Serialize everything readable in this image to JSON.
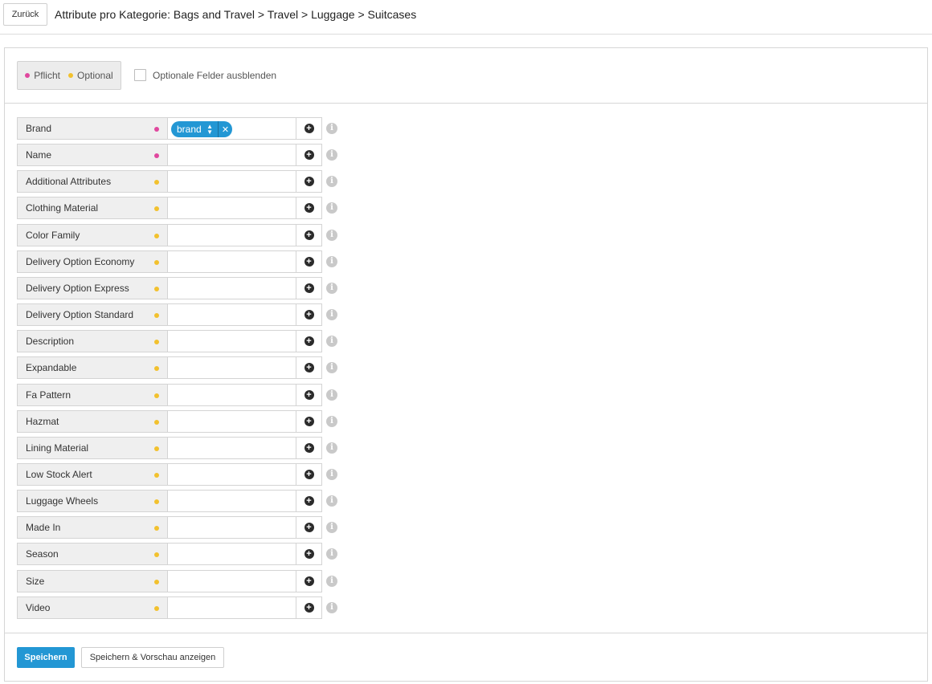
{
  "header": {
    "back_label": "Zurück",
    "title": "Attribute pro Kategorie: Bags and Travel > Travel > Luggage > Suitcases"
  },
  "legend": {
    "required_label": "Pflicht",
    "optional_label": "Optional",
    "required_color": "#e0479e",
    "optional_color": "#f2c12e"
  },
  "hide_optional": {
    "label": "Optionale Felder ausblenden",
    "checked": false
  },
  "attributes": [
    {
      "label": "Brand",
      "required": true,
      "tag": "brand"
    },
    {
      "label": "Name",
      "required": true
    },
    {
      "label": "Additional Attributes",
      "required": false
    },
    {
      "label": "Clothing Material",
      "required": false
    },
    {
      "label": "Color Family",
      "required": false
    },
    {
      "label": "Delivery Option Economy",
      "required": false
    },
    {
      "label": "Delivery Option Express",
      "required": false
    },
    {
      "label": "Delivery Option Standard",
      "required": false
    },
    {
      "label": "Description",
      "required": false
    },
    {
      "label": "Expandable",
      "required": false
    },
    {
      "label": "Fa Pattern",
      "required": false
    },
    {
      "label": "Hazmat",
      "required": false
    },
    {
      "label": "Lining Material",
      "required": false
    },
    {
      "label": "Low Stock Alert",
      "required": false
    },
    {
      "label": "Luggage Wheels",
      "required": false
    },
    {
      "label": "Made In",
      "required": false
    },
    {
      "label": "Season",
      "required": false
    },
    {
      "label": "Size",
      "required": false
    },
    {
      "label": "Video",
      "required": false
    }
  ],
  "footer": {
    "save_label": "Speichern",
    "save_preview_label": "Speichern & Vorschau anzeigen"
  },
  "colors": {
    "accent": "#2397d4"
  }
}
